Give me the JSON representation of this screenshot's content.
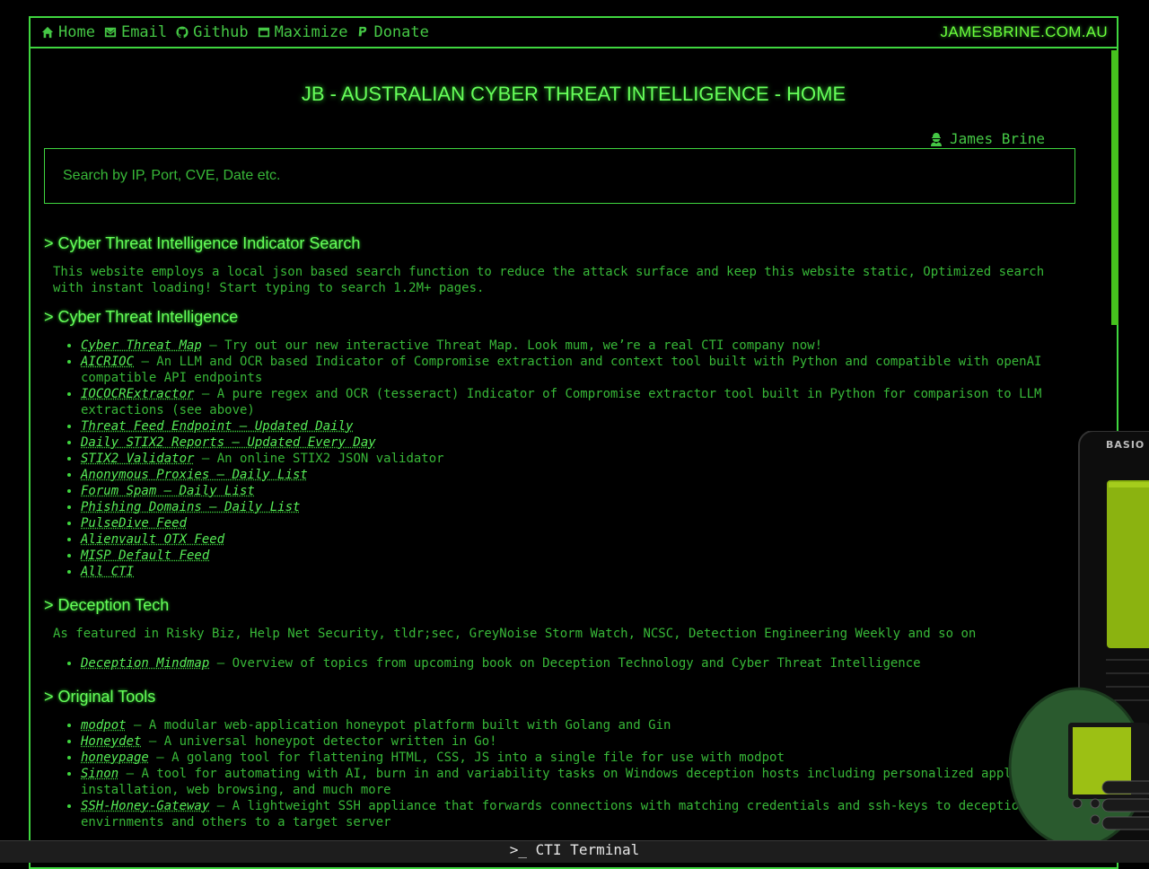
{
  "nav": {
    "items": [
      {
        "label": "Home",
        "icon": "home-icon"
      },
      {
        "label": "Email",
        "icon": "email-icon"
      },
      {
        "label": "Github",
        "icon": "github-icon"
      },
      {
        "label": "Maximize",
        "icon": "window-icon"
      },
      {
        "label": "Donate",
        "icon": "paypal-icon"
      }
    ],
    "brand": "JAMESBRINE.COM.AU"
  },
  "page": {
    "title": "JB - AUSTRALIAN CYBER THREAT INTELLIGENCE - HOME",
    "author": "James Brine"
  },
  "search": {
    "placeholder": "Search by IP, Port, CVE, Date etc."
  },
  "sections": {
    "indicator_search": {
      "heading": "> Cyber Threat Intelligence Indicator Search",
      "text": "This website employs a local json based search function to reduce the attack surface and keep this website static, Optimized search with instant loading! Start typing to search 1.2M+ pages."
    },
    "cti": {
      "heading": "> Cyber Threat Intelligence",
      "items": [
        {
          "link": "Cyber Threat Map",
          "desc": " – Try out our new interactive Threat Map. Look mum, we’re a real CTI company now!"
        },
        {
          "link": "AICRIOC",
          "desc": " – An LLM and OCR based Indicator of Compromise extraction and context tool built with Python and compatible with openAI compatible API endpoints"
        },
        {
          "link": "IOCOCRExtractor",
          "desc": " – A pure regex and OCR (tesseract) Indicator of Compromise extractor tool built in Python for comparison to LLM extractions (see above)"
        },
        {
          "link": "Threat Feed Endpoint – Updated Daily",
          "desc": ""
        },
        {
          "link": "Daily STIX2 Reports – Updated Every Day",
          "desc": ""
        },
        {
          "link": "STIX2 Validator",
          "desc": " – An online STIX2 JSON validator"
        },
        {
          "link": "Anonymous Proxies – Daily List",
          "desc": ""
        },
        {
          "link": "Forum Spam – Daily List",
          "desc": ""
        },
        {
          "link": "Phishing Domains – Daily List",
          "desc": ""
        },
        {
          "link": "PulseDive Feed",
          "desc": ""
        },
        {
          "link": "Alienvault OTX Feed",
          "desc": ""
        },
        {
          "link": "MISP Default Feed",
          "desc": ""
        },
        {
          "link": "All CTI",
          "desc": ""
        }
      ]
    },
    "deception": {
      "heading": "> Deception Tech",
      "text": "As featured in Risky Biz, Help Net Security, tldr;sec, GreyNoise Storm Watch, NCSC, Detection Engineering Weekly and so on",
      "items": [
        {
          "link": "Deception Mindmap",
          "desc": " – Overview of topics from upcoming book on Deception Technology and Cyber Threat Intelligence"
        }
      ]
    },
    "tools": {
      "heading": "> Original Tools",
      "items": [
        {
          "link": "modpot",
          "desc": " – A modular web-application honeypot platform built with Golang and Gin"
        },
        {
          "link": "Honeydet",
          "desc": " – A universal honeypot detector written in Go!"
        },
        {
          "link": "honeypage",
          "desc": " – A golang tool for flattening HTML, CSS, JS into a single file for use with modpot"
        },
        {
          "link": "Sinon",
          "desc": " – A tool for automating with AI, burn in and variability tasks on Windows deception hosts including personalized application installation, web browsing, and much more"
        },
        {
          "link": "SSH-Honey-Gateway",
          "desc": " – A lightweight SSH appliance that forwards connections with matching credentials and ssh-keys to deception envirnments and others to a target server"
        }
      ]
    }
  },
  "footer": {
    "terminal_label": ">_ CTI Terminal"
  },
  "device": {
    "label": "BASIO"
  },
  "colors": {
    "accent": "#3fd63f",
    "heading": "#67ff5a",
    "background": "#000000",
    "device_body": "#2a5a2e",
    "device_screen": "#8bb310"
  }
}
